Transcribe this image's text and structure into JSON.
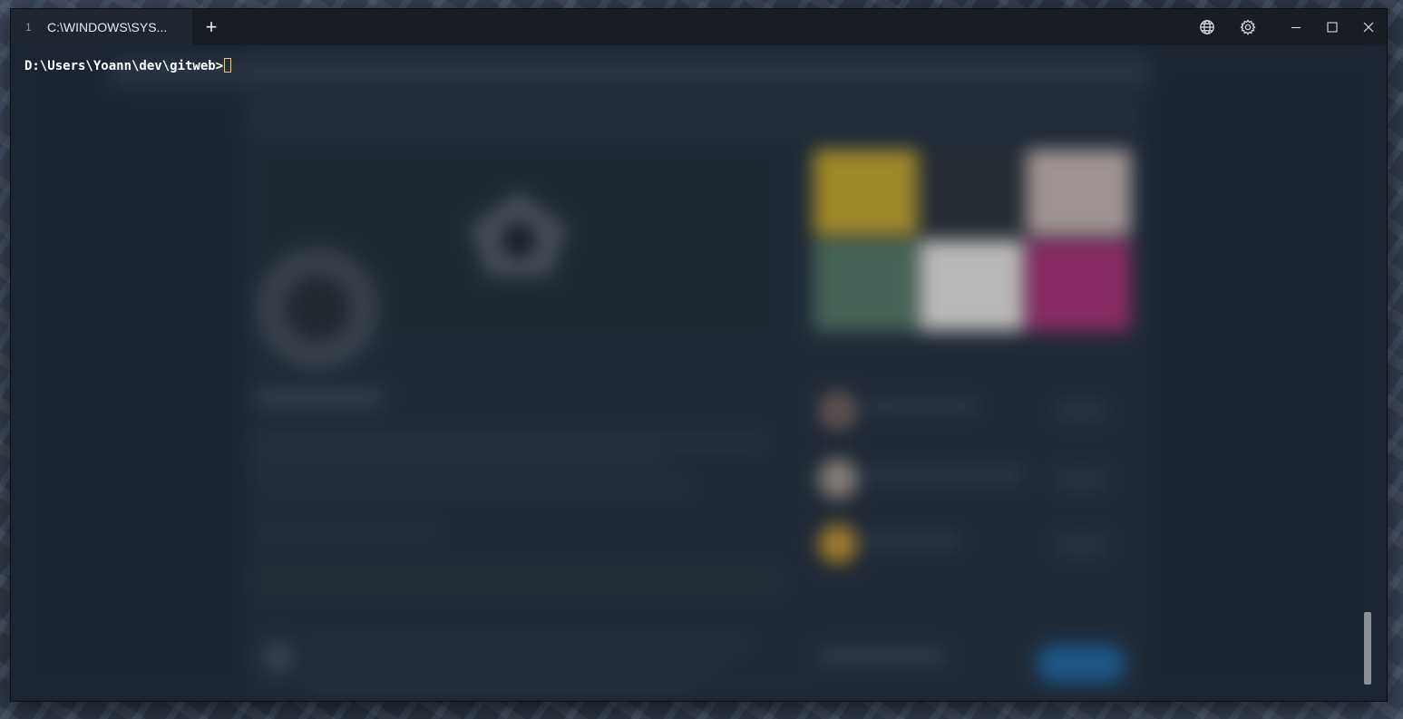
{
  "terminal": {
    "tab": {
      "index": "1",
      "title": "C:\\WINDOWS\\SYS..."
    },
    "new_tab_label": "+",
    "prompt": "D:\\Users\\Yoann\\dev\\gitweb>",
    "icons": {
      "globe": "globe-icon",
      "settings": "gear-icon",
      "minimize": "minimize-icon",
      "maximize": "maximize-icon",
      "close": "close-icon"
    },
    "colors": {
      "cursor": "#f2c94c",
      "background": "#1b2430",
      "titlebar": "#181d24"
    }
  }
}
